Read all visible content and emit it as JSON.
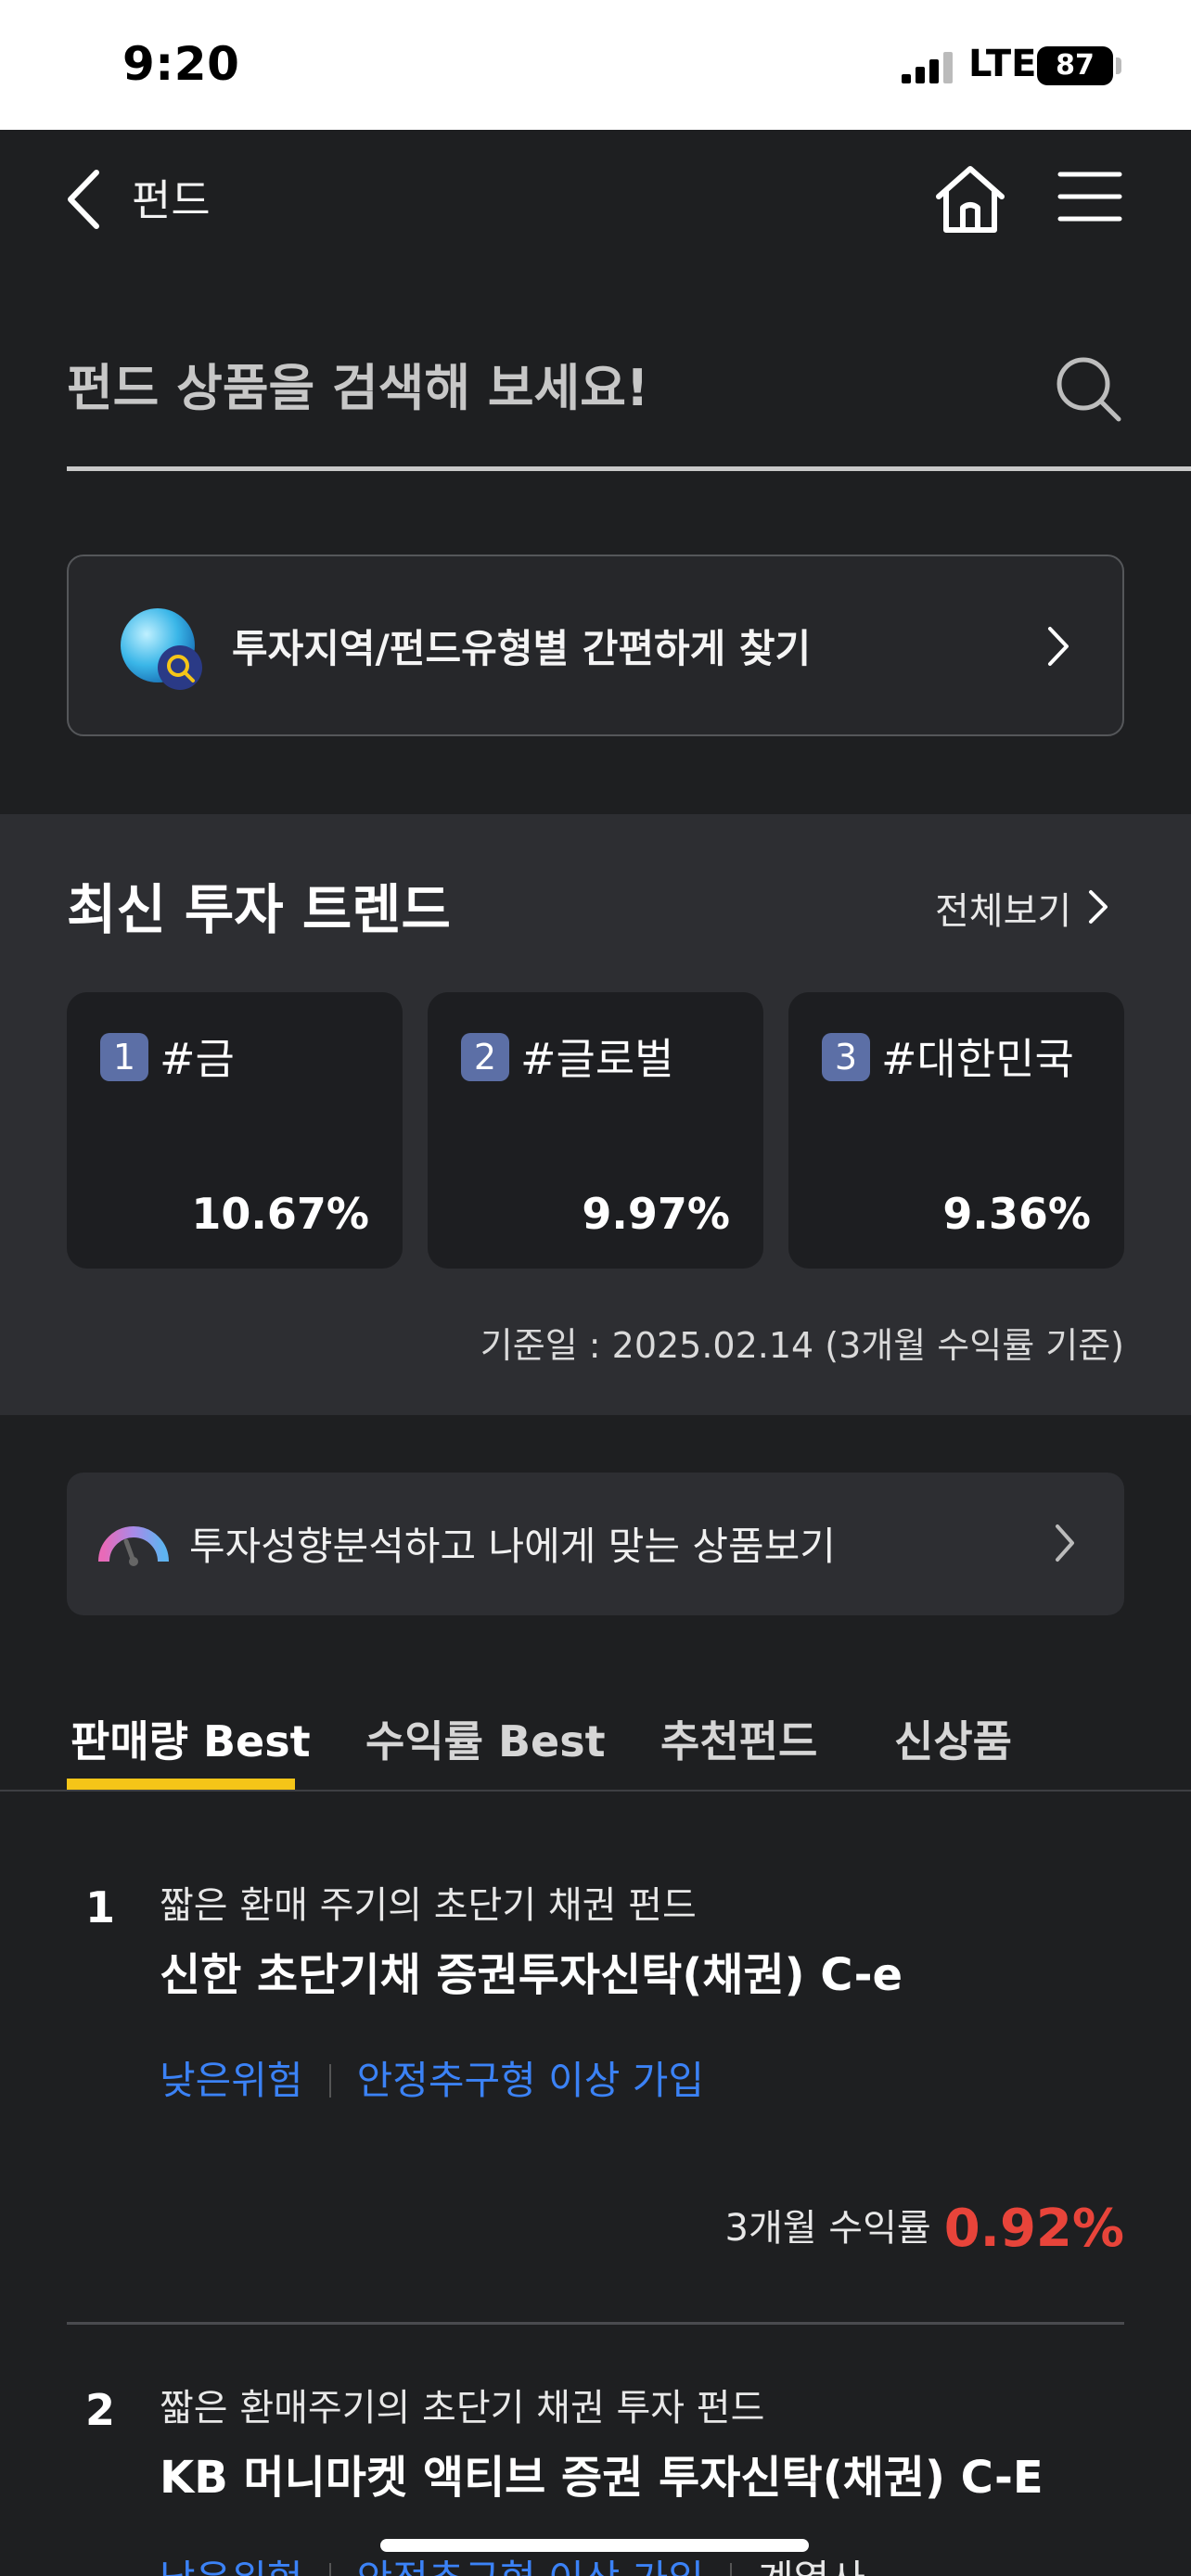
{
  "status_bar": {
    "time": "9:20",
    "network": "LTE",
    "battery": "87"
  },
  "nav": {
    "title": "펀드"
  },
  "search": {
    "placeholder": "펀드 상품을 검색해 보세요!"
  },
  "finder": {
    "label": "투자지역/펀드유형별 간편하게 찾기"
  },
  "trend": {
    "title": "최신 투자 트렌드",
    "view_all": "전체보기",
    "cards": [
      {
        "rank": "1",
        "tag": "#금",
        "rate": "10.67%"
      },
      {
        "rank": "2",
        "tag": "#글로벌",
        "rate": "9.97%"
      },
      {
        "rank": "3",
        "tag": "#대한민국",
        "rate": "9.36%"
      }
    ],
    "base_note": "기준일 : 2025.02.14 (3개월 수익률 기준)"
  },
  "propensity": {
    "label": "투자성향분석하고 나에게 맞는 상품보기"
  },
  "tabs": [
    {
      "label": "판매량 Best",
      "active": true
    },
    {
      "label": "수익률 Best",
      "active": false
    },
    {
      "label": "추천펀드",
      "active": false
    },
    {
      "label": "신상품",
      "active": false
    }
  ],
  "funds": [
    {
      "rank": "1",
      "description": "짧은 환매 주기의 초단기 채권 펀드",
      "name": "신한 초단기채 증권투자신탁(채권) C-e",
      "risk_level": "낮은위험",
      "eligibility": "안정추구형 이상 가입",
      "return_label": "3개월 수익률",
      "return_value": "0.92%"
    },
    {
      "rank": "2",
      "description": "짧은 환매주기의 초단기 채권 투자 펀드",
      "name": "KB 머니마켓 액티브 증권 투자신탁(채권) C-E",
      "risk_level": "낮은위험",
      "eligibility": "안정추구형 이상 가입",
      "extra": "계열사"
    }
  ],
  "colors": {
    "background": "#1e1f21",
    "section_bg": "#2d2e32",
    "accent_yellow": "#f5c518",
    "risk_blue": "#3b82f6",
    "return_red": "#e8443a",
    "rank_badge": "#5c6fa6"
  }
}
